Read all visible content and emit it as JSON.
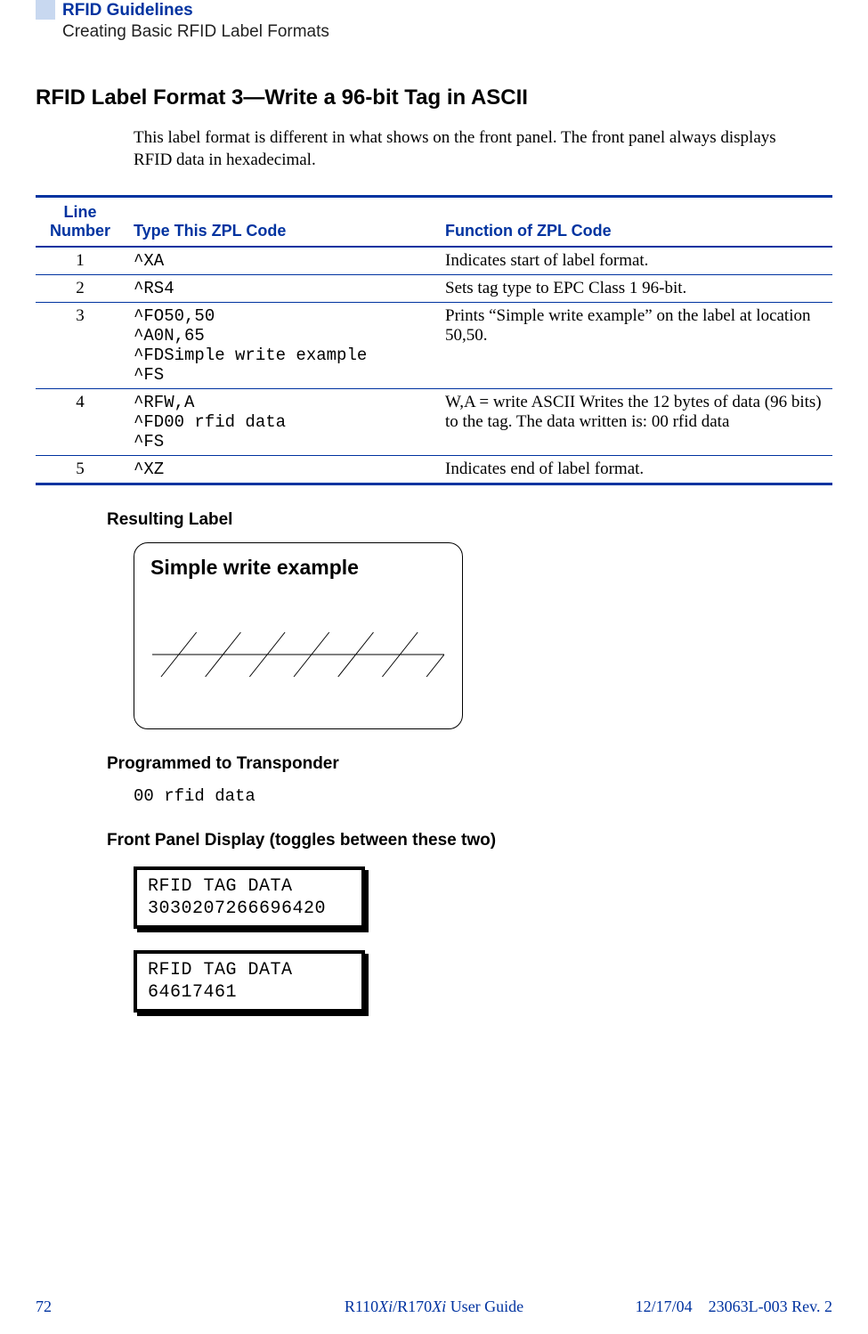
{
  "header": {
    "title": "RFID Guidelines",
    "subtitle": "Creating Basic RFID Label Formats"
  },
  "section_title": "RFID Label Format 3—Write a 96-bit Tag in ASCII",
  "intro": "This label format is different in what shows on the front panel. The front panel always displays RFID data in hexadecimal.",
  "table": {
    "headers": {
      "line": "Line Number",
      "code": "Type This ZPL Code",
      "func": "Function of ZPL Code"
    },
    "rows": [
      {
        "line": "1",
        "code": "^XA",
        "func": "Indicates start of label format."
      },
      {
        "line": "2",
        "code": "^RS4",
        "func": "Sets tag type to EPC Class 1 96-bit."
      },
      {
        "line": "3",
        "code": "^FO50,50\n^A0N,65\n^FDSimple write example\n^FS",
        "func": "Prints “Simple write example” on the label at location 50,50."
      },
      {
        "line": "4",
        "code": "^RFW,A\n^FD00 rfid data\n^FS",
        "func": "W,A = write ASCII\nWrites the 12 bytes of data (96 bits) to the tag. The data written is: 00 rfid data"
      },
      {
        "line": "5",
        "code": "^XZ",
        "func": "Indicates end of label format."
      }
    ]
  },
  "resulting_label": {
    "heading": "Resulting Label",
    "text": "Simple write example"
  },
  "programmed": {
    "heading": "Programmed to Transponder",
    "value": "00 rfid data"
  },
  "front_panel": {
    "heading": "Front Panel Display (toggles between these two)",
    "panels": [
      {
        "line1": "RFID TAG DATA",
        "line2": "3030207266696420"
      },
      {
        "line1": "RFID TAG DATA",
        "line2": "64617461"
      }
    ]
  },
  "footer": {
    "page": "72",
    "center_prefix": "R110",
    "center_ital1": "Xi",
    "center_mid": "/R170",
    "center_ital2": "Xi",
    "center_suffix": " User Guide",
    "date": "12/17/04",
    "rev": "23063L-003 Rev. 2"
  }
}
